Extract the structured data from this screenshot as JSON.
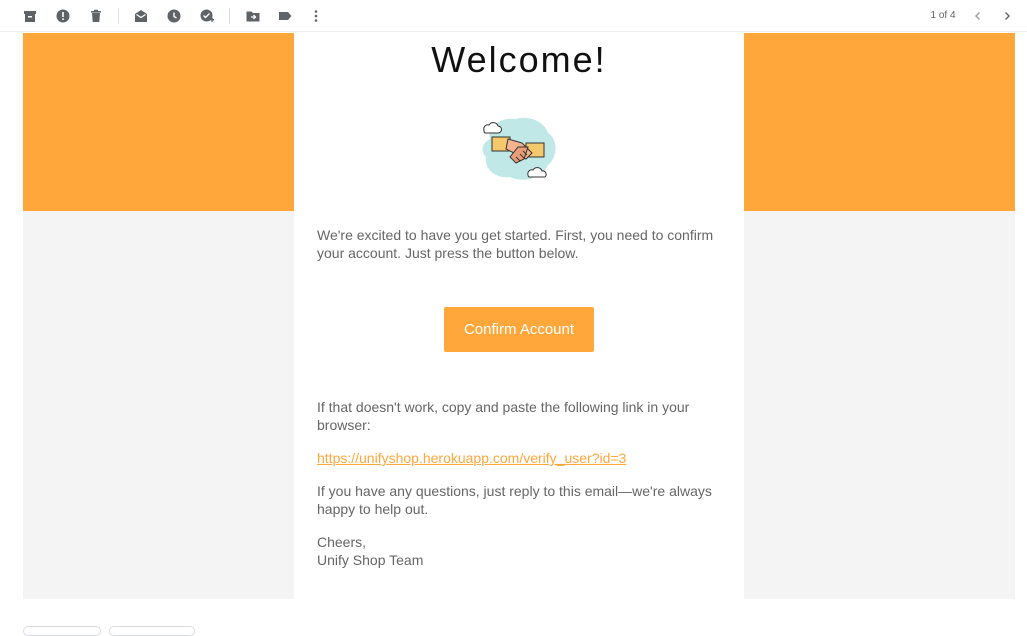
{
  "toolbar": {
    "icons": [
      "archive-icon",
      "report-spam-icon",
      "delete-icon",
      "mark-unread-icon",
      "snooze-icon",
      "add-to-tasks-icon",
      "move-to-icon",
      "label-icon",
      "more-icon"
    ],
    "pager_text": "1 of 4"
  },
  "email": {
    "title": "Welcome!",
    "intro_line1": "We're excited to have you get started. First, you need to confirm",
    "intro_line2": "your account. Just press the button below.",
    "button_label": "Confirm Account",
    "fallback_line1": "If that doesn't work, copy and paste the following link in your",
    "fallback_line2": "browser:",
    "verify_link": "https://unifyshop.herokuapp.com/verify_user?id=3",
    "questions_line1": "If you have any questions, just reply to this email—we're always",
    "questions_line2": "happy to help out.",
    "signoff": "Cheers,",
    "team": "Unify Shop Team"
  },
  "colors": {
    "accent": "#FFA73B",
    "background": "#F4F4F4",
    "text": "#666666",
    "title": "#111111"
  }
}
